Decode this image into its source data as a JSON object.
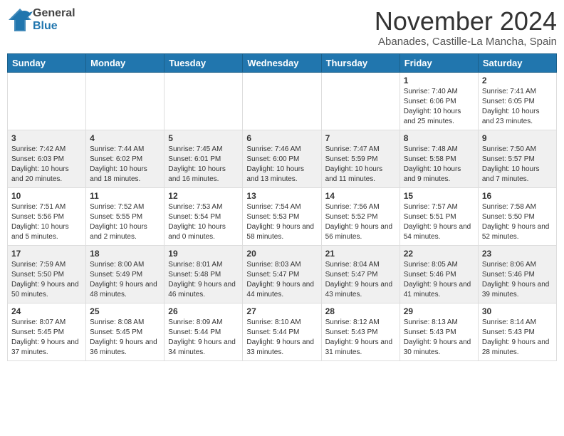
{
  "header": {
    "logo_line1": "General",
    "logo_line2": "Blue",
    "month": "November 2024",
    "location": "Abanades, Castille-La Mancha, Spain"
  },
  "days_of_week": [
    "Sunday",
    "Monday",
    "Tuesday",
    "Wednesday",
    "Thursday",
    "Friday",
    "Saturday"
  ],
  "weeks": [
    [
      {
        "day": "",
        "info": ""
      },
      {
        "day": "",
        "info": ""
      },
      {
        "day": "",
        "info": ""
      },
      {
        "day": "",
        "info": ""
      },
      {
        "day": "",
        "info": ""
      },
      {
        "day": "1",
        "info": "Sunrise: 7:40 AM\nSunset: 6:06 PM\nDaylight: 10 hours and 25 minutes."
      },
      {
        "day": "2",
        "info": "Sunrise: 7:41 AM\nSunset: 6:05 PM\nDaylight: 10 hours and 23 minutes."
      }
    ],
    [
      {
        "day": "3",
        "info": "Sunrise: 7:42 AM\nSunset: 6:03 PM\nDaylight: 10 hours and 20 minutes."
      },
      {
        "day": "4",
        "info": "Sunrise: 7:44 AM\nSunset: 6:02 PM\nDaylight: 10 hours and 18 minutes."
      },
      {
        "day": "5",
        "info": "Sunrise: 7:45 AM\nSunset: 6:01 PM\nDaylight: 10 hours and 16 minutes."
      },
      {
        "day": "6",
        "info": "Sunrise: 7:46 AM\nSunset: 6:00 PM\nDaylight: 10 hours and 13 minutes."
      },
      {
        "day": "7",
        "info": "Sunrise: 7:47 AM\nSunset: 5:59 PM\nDaylight: 10 hours and 11 minutes."
      },
      {
        "day": "8",
        "info": "Sunrise: 7:48 AM\nSunset: 5:58 PM\nDaylight: 10 hours and 9 minutes."
      },
      {
        "day": "9",
        "info": "Sunrise: 7:50 AM\nSunset: 5:57 PM\nDaylight: 10 hours and 7 minutes."
      }
    ],
    [
      {
        "day": "10",
        "info": "Sunrise: 7:51 AM\nSunset: 5:56 PM\nDaylight: 10 hours and 5 minutes."
      },
      {
        "day": "11",
        "info": "Sunrise: 7:52 AM\nSunset: 5:55 PM\nDaylight: 10 hours and 2 minutes."
      },
      {
        "day": "12",
        "info": "Sunrise: 7:53 AM\nSunset: 5:54 PM\nDaylight: 10 hours and 0 minutes."
      },
      {
        "day": "13",
        "info": "Sunrise: 7:54 AM\nSunset: 5:53 PM\nDaylight: 9 hours and 58 minutes."
      },
      {
        "day": "14",
        "info": "Sunrise: 7:56 AM\nSunset: 5:52 PM\nDaylight: 9 hours and 56 minutes."
      },
      {
        "day": "15",
        "info": "Sunrise: 7:57 AM\nSunset: 5:51 PM\nDaylight: 9 hours and 54 minutes."
      },
      {
        "day": "16",
        "info": "Sunrise: 7:58 AM\nSunset: 5:50 PM\nDaylight: 9 hours and 52 minutes."
      }
    ],
    [
      {
        "day": "17",
        "info": "Sunrise: 7:59 AM\nSunset: 5:50 PM\nDaylight: 9 hours and 50 minutes."
      },
      {
        "day": "18",
        "info": "Sunrise: 8:00 AM\nSunset: 5:49 PM\nDaylight: 9 hours and 48 minutes."
      },
      {
        "day": "19",
        "info": "Sunrise: 8:01 AM\nSunset: 5:48 PM\nDaylight: 9 hours and 46 minutes."
      },
      {
        "day": "20",
        "info": "Sunrise: 8:03 AM\nSunset: 5:47 PM\nDaylight: 9 hours and 44 minutes."
      },
      {
        "day": "21",
        "info": "Sunrise: 8:04 AM\nSunset: 5:47 PM\nDaylight: 9 hours and 43 minutes."
      },
      {
        "day": "22",
        "info": "Sunrise: 8:05 AM\nSunset: 5:46 PM\nDaylight: 9 hours and 41 minutes."
      },
      {
        "day": "23",
        "info": "Sunrise: 8:06 AM\nSunset: 5:46 PM\nDaylight: 9 hours and 39 minutes."
      }
    ],
    [
      {
        "day": "24",
        "info": "Sunrise: 8:07 AM\nSunset: 5:45 PM\nDaylight: 9 hours and 37 minutes."
      },
      {
        "day": "25",
        "info": "Sunrise: 8:08 AM\nSunset: 5:45 PM\nDaylight: 9 hours and 36 minutes."
      },
      {
        "day": "26",
        "info": "Sunrise: 8:09 AM\nSunset: 5:44 PM\nDaylight: 9 hours and 34 minutes."
      },
      {
        "day": "27",
        "info": "Sunrise: 8:10 AM\nSunset: 5:44 PM\nDaylight: 9 hours and 33 minutes."
      },
      {
        "day": "28",
        "info": "Sunrise: 8:12 AM\nSunset: 5:43 PM\nDaylight: 9 hours and 31 minutes."
      },
      {
        "day": "29",
        "info": "Sunrise: 8:13 AM\nSunset: 5:43 PM\nDaylight: 9 hours and 30 minutes."
      },
      {
        "day": "30",
        "info": "Sunrise: 8:14 AM\nSunset: 5:43 PM\nDaylight: 9 hours and 28 minutes."
      }
    ]
  ]
}
